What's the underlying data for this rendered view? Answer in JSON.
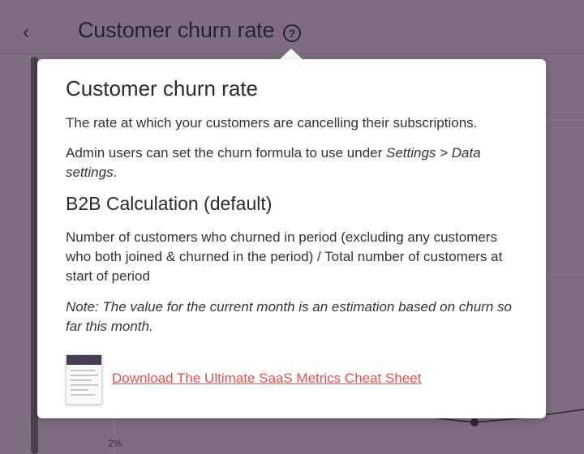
{
  "header": {
    "title": "Customer churn rate",
    "help_glyph": "?",
    "back_glyph": "‹"
  },
  "background_chart": {
    "y_tick_label": "2%"
  },
  "popover": {
    "title": "Customer churn rate",
    "description": "The rate at which your customers are cancelling their subscriptions.",
    "admin_note_prefix": "Admin users can set the churn formula to use under ",
    "admin_note_link_text": "Settings > Data settings",
    "admin_note_suffix": ".",
    "calc_heading": "B2B Calculation (default)",
    "calc_text": "Number of customers who churned in period (excluding any customers who both joined & churned in the period) / Total number of customers at start of period",
    "note": "Note: The value for the current month is an estimation based on churn so far this month.",
    "download_label": "Download The Ultimate SaaS Metrics Cheat Sheet"
  },
  "colors": {
    "overlay": "#7e6c80",
    "link": "#e05050",
    "popover_bg": "#ffffff"
  },
  "icons": {
    "back": "chevron-left-icon",
    "help": "question-circle-icon",
    "document": "document-thumbnail-icon"
  }
}
